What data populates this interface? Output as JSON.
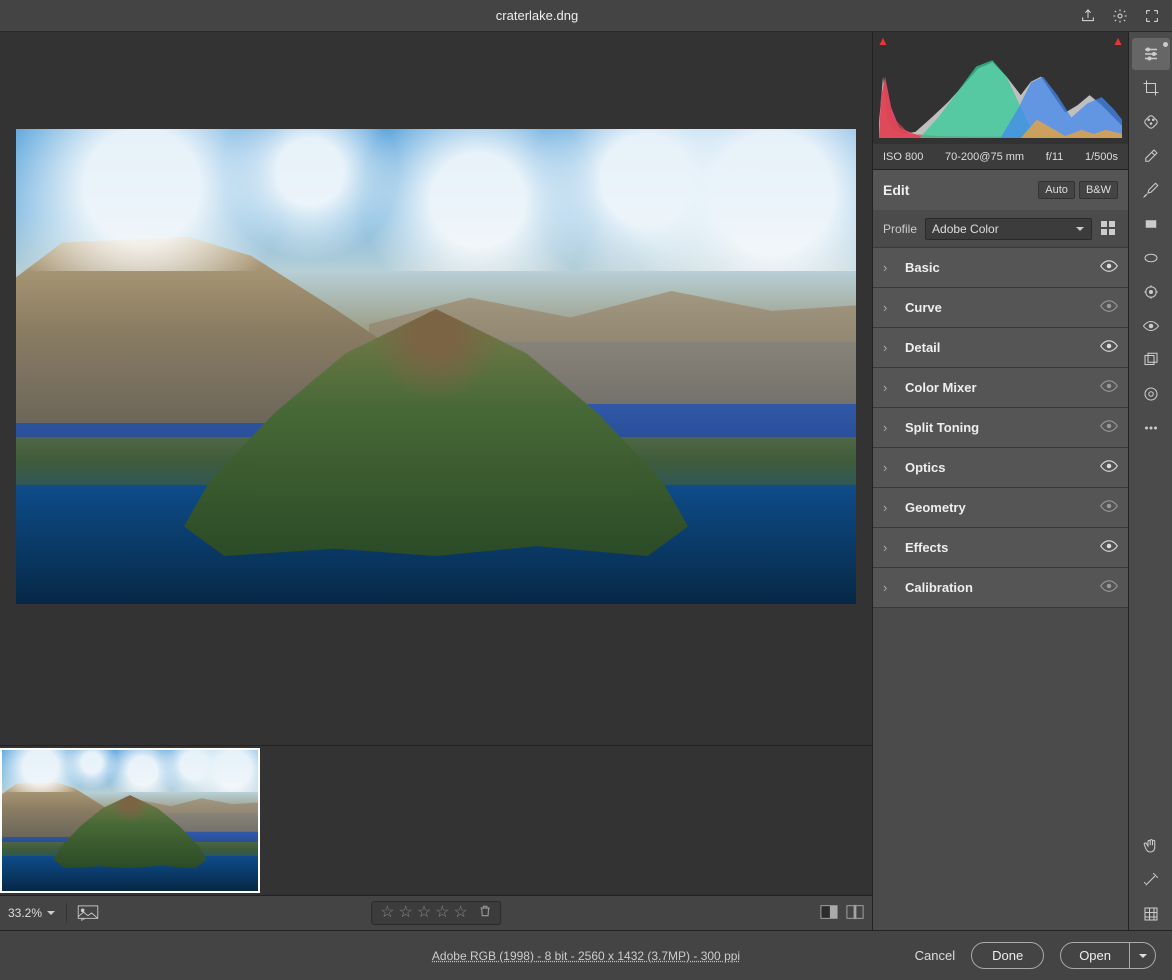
{
  "topbar": {
    "title": "craterlake.dng"
  },
  "shot": {
    "iso": "ISO 800",
    "lens": "70-200@75 mm",
    "aperture": "f/11",
    "shutter": "1/500s"
  },
  "edit": {
    "title": "Edit",
    "auto": "Auto",
    "bw": "B&W",
    "profile_label": "Profile",
    "profile_value": "Adobe Color"
  },
  "sections": [
    {
      "name": "Basic",
      "eye_on": true
    },
    {
      "name": "Curve",
      "eye_on": false
    },
    {
      "name": "Detail",
      "eye_on": true
    },
    {
      "name": "Color Mixer",
      "eye_on": false
    },
    {
      "name": "Split Toning",
      "eye_on": false
    },
    {
      "name": "Optics",
      "eye_on": true
    },
    {
      "name": "Geometry",
      "eye_on": false
    },
    {
      "name": "Effects",
      "eye_on": true
    },
    {
      "name": "Calibration",
      "eye_on": false
    }
  ],
  "viewer": {
    "zoom": "33.2%",
    "image_info": "Adobe RGB (1998) - 8 bit - 2560 x 1432 (3.7MP) - 300 ppi"
  },
  "buttons": {
    "cancel": "Cancel",
    "done": "Done",
    "open": "Open"
  }
}
